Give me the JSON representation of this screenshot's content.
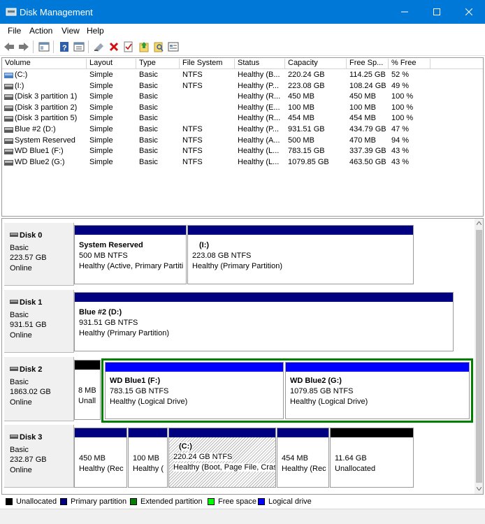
{
  "window": {
    "title": "Disk Management",
    "accent": "#0078d7"
  },
  "menu": [
    "File",
    "Action",
    "View",
    "Help"
  ],
  "toolbar": [
    "back-icon",
    "forward-icon",
    "properties-icon",
    "help-icon",
    "console-icon",
    "connect-icon",
    "delete-icon",
    "check-icon",
    "open-icon",
    "search-icon",
    "settings-icon"
  ],
  "columns": [
    "Volume",
    "Layout",
    "Type",
    "File System",
    "Status",
    "Capacity",
    "Free Sp...",
    "% Free"
  ],
  "volumes": [
    {
      "name": "(C:)",
      "layout": "Simple",
      "type": "Basic",
      "fs": "NTFS",
      "status": "Healthy (B...",
      "capacity": "220.24 GB",
      "free": "114.25 GB",
      "pct": "52 %"
    },
    {
      "name": "(I:)",
      "layout": "Simple",
      "type": "Basic",
      "fs": "NTFS",
      "status": "Healthy (P...",
      "capacity": "223.08 GB",
      "free": "108.24 GB",
      "pct": "49 %"
    },
    {
      "name": "(Disk 3 partition 1)",
      "layout": "Simple",
      "type": "Basic",
      "fs": "",
      "status": "Healthy (R...",
      "capacity": "450 MB",
      "free": "450 MB",
      "pct": "100 %"
    },
    {
      "name": "(Disk 3 partition 2)",
      "layout": "Simple",
      "type": "Basic",
      "fs": "",
      "status": "Healthy (E...",
      "capacity": "100 MB",
      "free": "100 MB",
      "pct": "100 %"
    },
    {
      "name": "(Disk 3 partition 5)",
      "layout": "Simple",
      "type": "Basic",
      "fs": "",
      "status": "Healthy (R...",
      "capacity": "454 MB",
      "free": "454 MB",
      "pct": "100 %"
    },
    {
      "name": "Blue #2 (D:)",
      "layout": "Simple",
      "type": "Basic",
      "fs": "NTFS",
      "status": "Healthy (P...",
      "capacity": "931.51 GB",
      "free": "434.79 GB",
      "pct": "47 %"
    },
    {
      "name": "System Reserved",
      "layout": "Simple",
      "type": "Basic",
      "fs": "NTFS",
      "status": "Healthy (A...",
      "capacity": "500 MB",
      "free": "470 MB",
      "pct": "94 %"
    },
    {
      "name": "WD Blue1 (F:)",
      "layout": "Simple",
      "type": "Basic",
      "fs": "NTFS",
      "status": "Healthy (L...",
      "capacity": "783.15 GB",
      "free": "337.39 GB",
      "pct": "43 %"
    },
    {
      "name": "WD Blue2 (G:)",
      "layout": "Simple",
      "type": "Basic",
      "fs": "NTFS",
      "status": "Healthy (L...",
      "capacity": "1079.85 GB",
      "free": "463.50 GB",
      "pct": "43 %"
    }
  ],
  "disks": [
    {
      "name": "Disk 0",
      "type": "Basic",
      "size": "223.57 GB",
      "state": "Online",
      "parts": [
        {
          "title": "System Reserved",
          "line2": "500 MB NTFS",
          "line3": "Healthy (Active, Primary Partiti"
        },
        {
          "title": "(I:)",
          "line2": "223.08 GB NTFS",
          "line3": "Healthy (Primary Partition)"
        }
      ]
    },
    {
      "name": "Disk 1",
      "type": "Basic",
      "size": "931.51 GB",
      "state": "Online",
      "parts": [
        {
          "title": "Blue #2  (D:)",
          "line2": "931.51 GB NTFS",
          "line3": "Healthy (Primary Partition)"
        }
      ]
    },
    {
      "name": "Disk 2",
      "type": "Basic",
      "size": "1863.02 GB",
      "state": "Online",
      "parts": [
        {
          "title": "",
          "line2": "8 MB",
          "line3": "Unall"
        },
        {
          "title": "WD Blue1  (F:)",
          "line2": "783.15 GB NTFS",
          "line3": "Healthy (Logical Drive)"
        },
        {
          "title": "WD Blue2  (G:)",
          "line2": "1079.85 GB NTFS",
          "line3": "Healthy (Logical Drive)"
        }
      ]
    },
    {
      "name": "Disk 3",
      "type": "Basic",
      "size": "232.87 GB",
      "state": "Online",
      "parts": [
        {
          "title": "",
          "line2": "450 MB",
          "line3": "Healthy (Rec"
        },
        {
          "title": "",
          "line2": "100 MB",
          "line3": "Healthy ("
        },
        {
          "title": "(C:)",
          "line2": "220.24 GB NTFS",
          "line3": "Healthy (Boot, Page File, Cras"
        },
        {
          "title": "",
          "line2": "454 MB",
          "line3": "Healthy (Rec"
        },
        {
          "title": "",
          "line2": "11.64 GB",
          "line3": "Unallocated"
        }
      ]
    }
  ],
  "legend": [
    {
      "label": "Unallocated",
      "color": "#000000"
    },
    {
      "label": "Primary partition",
      "color": "#000080"
    },
    {
      "label": "Extended partition",
      "color": "#008000"
    },
    {
      "label": "Free space",
      "color": "#00ff00"
    },
    {
      "label": "Logical drive",
      "color": "#0000ff"
    }
  ]
}
